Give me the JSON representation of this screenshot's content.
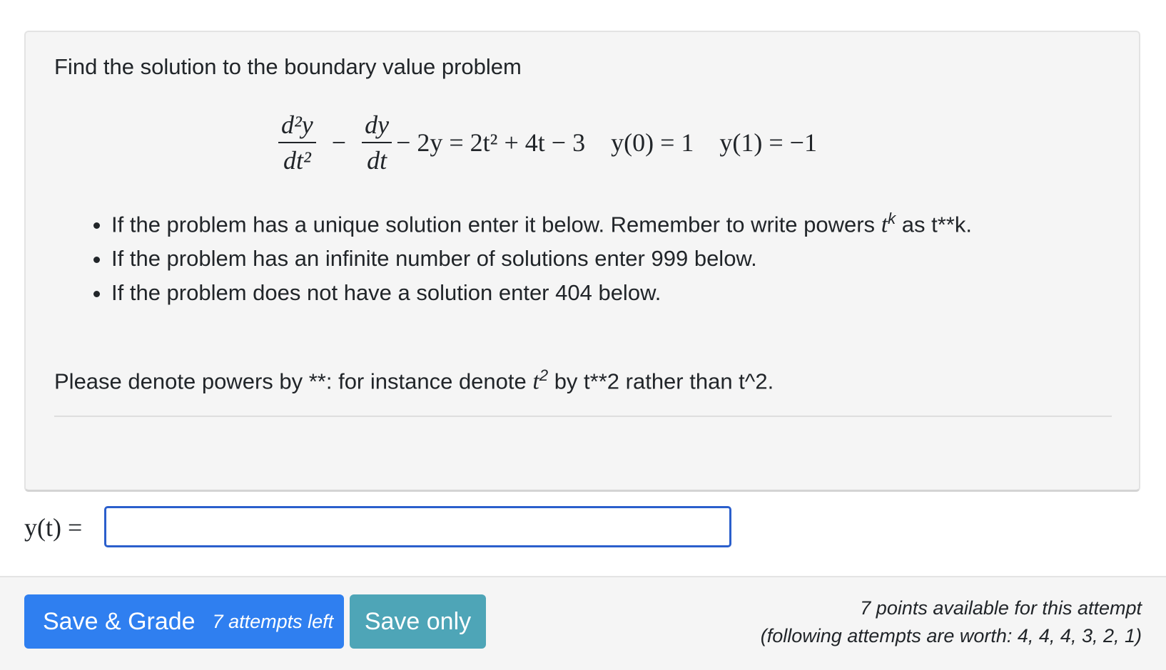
{
  "problem": {
    "intro": "Find the solution to the boundary value problem",
    "equation": {
      "frac1_num": "d²y",
      "frac1_den": "dt²",
      "minus1": "−",
      "frac2_num": "dy",
      "frac2_den": "dt",
      "rest": "− 2y = 2t² + 4t − 3",
      "bc1": "y(0) = 1",
      "bc2": "y(1) = −1"
    },
    "bullets": [
      {
        "text": "If the problem has a unique solution enter it below. Remember to write powers ",
        "math": "t",
        "sup": "k",
        "after": " as t**k."
      },
      {
        "text": "If the problem has an infinite number of solutions enter 999 below."
      },
      {
        "text": "If the problem does not have a solution enter 404 below."
      }
    ],
    "note": {
      "before": "Please denote powers by **: for instance denote ",
      "math": "t",
      "sup": "2",
      "after": " by t**2 rather than t^2."
    }
  },
  "answer": {
    "label": "y(t) =",
    "value": "",
    "placeholder": ""
  },
  "footer": {
    "grade_label": "Save & Grade",
    "attempts_left": "7 attempts left",
    "save_only_label": "Save only",
    "points_line1": "7 points available for this attempt",
    "points_line2": "(following attempts are worth: 4, 4, 4, 3, 2, 1)"
  },
  "colors": {
    "primary": "#2f7ff0",
    "info": "#4ea5b7",
    "input_border": "#2b5fcc",
    "panel_bg": "#f5f5f5"
  }
}
